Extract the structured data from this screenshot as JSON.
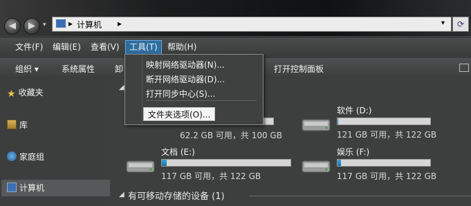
{
  "address": {
    "path": "计算机",
    "arrow": "▸"
  },
  "nav": {
    "back": "◀",
    "forward": "▶"
  },
  "menubar": {
    "items": [
      "文件(F)",
      "编辑(E)",
      "查看(V)",
      "工具(T)",
      "帮助(H)"
    ]
  },
  "toolbar": {
    "organize": "组织 ▾",
    "system_properties": "系统属性",
    "uninstall_partial": "卸",
    "open_control_panel": "打开控制面板"
  },
  "sidebar": {
    "items": [
      {
        "label": "收藏夹",
        "icon": "star-icon"
      },
      {
        "label": "库",
        "icon": "library-icon"
      },
      {
        "label": "家庭组",
        "icon": "homegroup-icon"
      },
      {
        "label": "计算机",
        "icon": "computer-icon"
      }
    ]
  },
  "drives": [
    {
      "name": "",
      "space": "62.2 GB 可用，共 100 GB",
      "used_fraction": 0.38
    },
    {
      "name": "软件 (D:)",
      "space": "121 GB 可用，共 122 GB",
      "used_fraction": 0.01
    },
    {
      "name": "文档 (E:)",
      "space": "117 GB 可用，共 122 GB",
      "used_fraction": 0.04
    },
    {
      "name": "娱乐 (F:)",
      "space": "117 GB 可用，共 122 GB",
      "used_fraction": 0.04
    }
  ],
  "sections": {
    "removable": "有可移动存储的设备 (1)"
  },
  "dropdown": {
    "items": [
      "映射网络驱动器(N)...",
      "断开网络驱动器(D)...",
      "打开同步中心(S)..."
    ],
    "folder_options": "文件夹选项(O)..."
  },
  "colors": {
    "accent": "#2d6da0",
    "bar_fill": "#1a6fa6"
  }
}
